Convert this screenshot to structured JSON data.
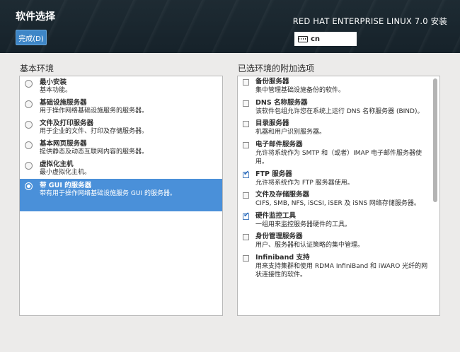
{
  "header": {
    "title": "软件选择",
    "done_label": "完成(D)",
    "product_title": "RED HAT ENTERPRISE LINUX 7.0 安装",
    "keyboard_layout": "cn"
  },
  "base_environment": {
    "heading": "基本环境",
    "items": [
      {
        "name": "最小安装",
        "desc": "基本功能。",
        "selected": false
      },
      {
        "name": "基础设施服务器",
        "desc": "用于操作网络基础设施服务的服务器。",
        "selected": false
      },
      {
        "name": "文件及打印服务器",
        "desc": "用于企业的文件、打印及存储服务器。",
        "selected": false
      },
      {
        "name": "基本网页服务器",
        "desc": "提供静态及动态互联网内容的服务器。",
        "selected": false
      },
      {
        "name": "虚拟化主机",
        "desc": "最小虚拟化主机。",
        "selected": false
      },
      {
        "name": "带 GUI 的服务器",
        "desc": "带有用于操作网络基础设施服务 GUI 的服务器。",
        "selected": true
      }
    ]
  },
  "addons": {
    "heading": "已选环境的附加选项",
    "items": [
      {
        "name": "备份服务器",
        "desc": "集中管理基础设施备份的软件。",
        "checked": false
      },
      {
        "name": "DNS 名称服务器",
        "desc": "该软件包组允许您在系统上运行 DNS 名称服务器 (BIND)。",
        "checked": false
      },
      {
        "name": "目录服务器",
        "desc": "机器和用户识别服务器。",
        "checked": false
      },
      {
        "name": "电子邮件服务器",
        "desc": "允许将系统作为 SMTP 和（或者）IMAP 电子邮件服务器使用。",
        "checked": false
      },
      {
        "name": "FTP 服务器",
        "desc": "允许将系统作为 FTP 服务器使用。",
        "checked": true
      },
      {
        "name": "文件及存储服务器",
        "desc": "CIFS, SMB, NFS, iSCSI, iSER 及 iSNS 网络存储服务器。",
        "checked": false
      },
      {
        "name": "硬件监控工具",
        "desc": "一组用来监控服务器硬件的工具。",
        "checked": true
      },
      {
        "name": "身份管理服务器",
        "desc": "用户、服务器和认证策略的集中管理。",
        "checked": false
      },
      {
        "name": "Infiniband 支持",
        "desc": "用来支持集群和使用 RDMA InfiniBand 和 iWARO 光纤的网状连接性的软件。",
        "checked": false
      }
    ]
  }
}
